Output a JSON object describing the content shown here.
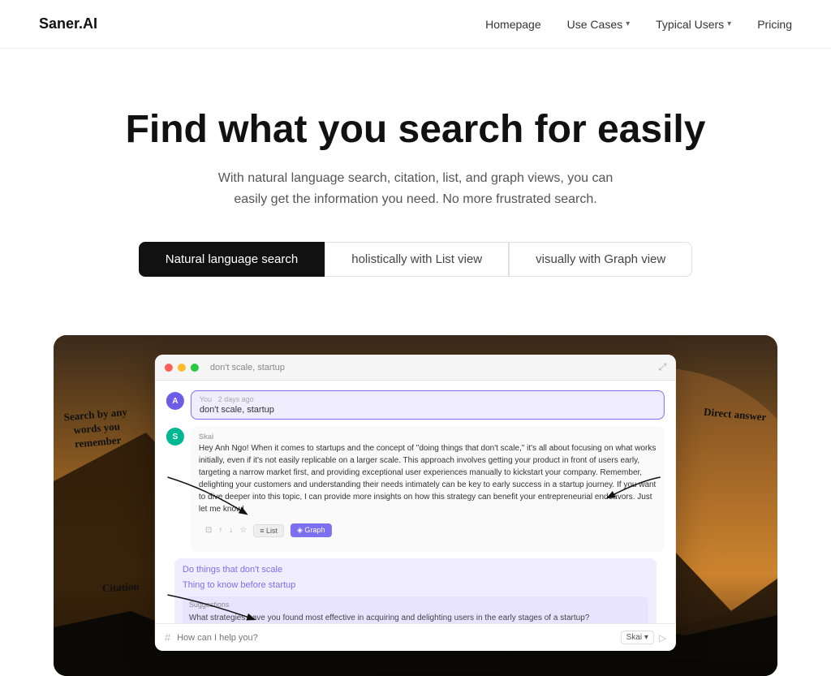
{
  "brand": {
    "logo": "Saner.AI"
  },
  "nav": {
    "links": [
      {
        "label": "Homepage",
        "has_dropdown": false
      },
      {
        "label": "Use Cases",
        "has_dropdown": true
      },
      {
        "label": "Typical Users",
        "has_dropdown": true
      },
      {
        "label": "Pricing",
        "has_dropdown": false
      }
    ]
  },
  "hero": {
    "title": "Find what you search for easily",
    "subtitle": "With natural language search, citation, list, and graph views, you can easily get the information you need. No more frustrated search."
  },
  "tabs": [
    {
      "label": "Natural language search",
      "active": true
    },
    {
      "label": "holistically with List view",
      "active": false
    },
    {
      "label": "visually with Graph view",
      "active": false
    }
  ],
  "app_window": {
    "title": "don't scale, startup",
    "user_msg": "don't scale, startup",
    "you_label": "You",
    "you_time": "2 days ago",
    "skai_label": "Skai",
    "skai_response": "Hey Anh Ngo! When it comes to startups and the concept of \"doing things that don't scale,\" it's all about focusing on what works initially, even if it's not easily replicable on a larger scale. This approach involves getting your product in front of users early, targeting a narrow market first, and providing exceptional user experiences manually to kickstart your company. Remember, delighting your customers and understanding their needs intimately can be key to early success in a startup journey. If you want to dive deeper into this topic, I can provide more insights on how this strategy can benefit your entrepreneurial endeavors. Just let me know!",
    "related_1": "Do things that don't scale",
    "related_2": "Thing to know before startup",
    "suggestions_label": "Suggestions",
    "suggestion_text": "What strategies have you found most effective in acquiring and delighting users in the early stages of a startup?",
    "chat_placeholder": "How can I help you?",
    "skai_model": "Skai"
  },
  "annotations": {
    "search": "Search by any\nwords you\nremember",
    "citation": "Citation",
    "answer": "Direct answer"
  },
  "colors": {
    "accent": "#7c6ff0",
    "active_tab_bg": "#111111",
    "active_tab_text": "#ffffff"
  }
}
